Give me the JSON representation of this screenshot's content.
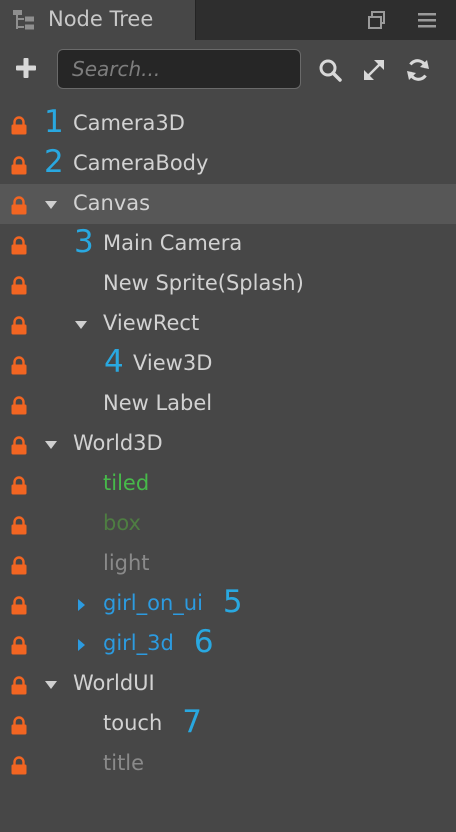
{
  "panel": {
    "title": "Node Tree",
    "title_icon": "node-tree-icon",
    "window_buttons": [
      "restore-icon",
      "menu-icon"
    ]
  },
  "toolbar": {
    "add_icon": "plus-icon",
    "search_placeholder": "Search...",
    "search_value": "",
    "search_icon": "search-icon",
    "expand_icon": "expand-arrows-icon",
    "refresh_icon": "refresh-icon"
  },
  "colors": {
    "lock": "#f26522",
    "callout": "#29a8e0",
    "prefab_blue": "#2c9be0",
    "green": "#47b94a",
    "dim_green": "#4e7d42",
    "inactive_gray": "#8a8a8a",
    "text": "#d2d2d2"
  },
  "tree": {
    "nodes": [
      {
        "label": "Camera3D",
        "callout": "1",
        "depth": 0,
        "expander": "none",
        "style": "default",
        "selected": false
      },
      {
        "label": "CameraBody",
        "callout": "2",
        "depth": 0,
        "expander": "none",
        "style": "default",
        "selected": false
      },
      {
        "label": "Canvas",
        "callout": "",
        "depth": 0,
        "expander": "expanded",
        "style": "default",
        "selected": true
      },
      {
        "label": "Main Camera",
        "callout": "3",
        "depth": 1,
        "expander": "none",
        "style": "default",
        "selected": false
      },
      {
        "label": "New Sprite(Splash)",
        "callout": "",
        "depth": 1,
        "expander": "none",
        "style": "default",
        "selected": false
      },
      {
        "label": "ViewRect",
        "callout": "",
        "depth": 1,
        "expander": "expanded",
        "style": "default",
        "selected": false
      },
      {
        "label": "View3D",
        "callout": "4",
        "depth": 2,
        "expander": "none",
        "style": "default",
        "selected": false
      },
      {
        "label": "New Label",
        "callout": "",
        "depth": 1,
        "expander": "none",
        "style": "default",
        "selected": false
      },
      {
        "label": "World3D",
        "callout": "",
        "depth": 0,
        "expander": "expanded",
        "style": "default",
        "selected": false
      },
      {
        "label": "tiled",
        "callout": "",
        "depth": 1,
        "expander": "none",
        "style": "green",
        "selected": false
      },
      {
        "label": "box",
        "callout": "",
        "depth": 1,
        "expander": "none",
        "style": "dimgreen",
        "selected": false
      },
      {
        "label": "light",
        "callout": "",
        "depth": 1,
        "expander": "none",
        "style": "gray",
        "selected": false
      },
      {
        "label": "girl_on_ui",
        "callout": "5",
        "depth": 1,
        "expander": "collapsed",
        "style": "blue",
        "selected": false
      },
      {
        "label": "girl_3d",
        "callout": "6",
        "depth": 1,
        "expander": "collapsed",
        "style": "blue",
        "selected": false
      },
      {
        "label": "WorldUI",
        "callout": "",
        "depth": 0,
        "expander": "expanded",
        "style": "default",
        "selected": false
      },
      {
        "label": "touch",
        "callout": "7",
        "depth": 1,
        "expander": "none",
        "style": "default",
        "selected": false
      },
      {
        "label": "title",
        "callout": "",
        "depth": 1,
        "expander": "none",
        "style": "gray",
        "selected": false
      }
    ]
  }
}
